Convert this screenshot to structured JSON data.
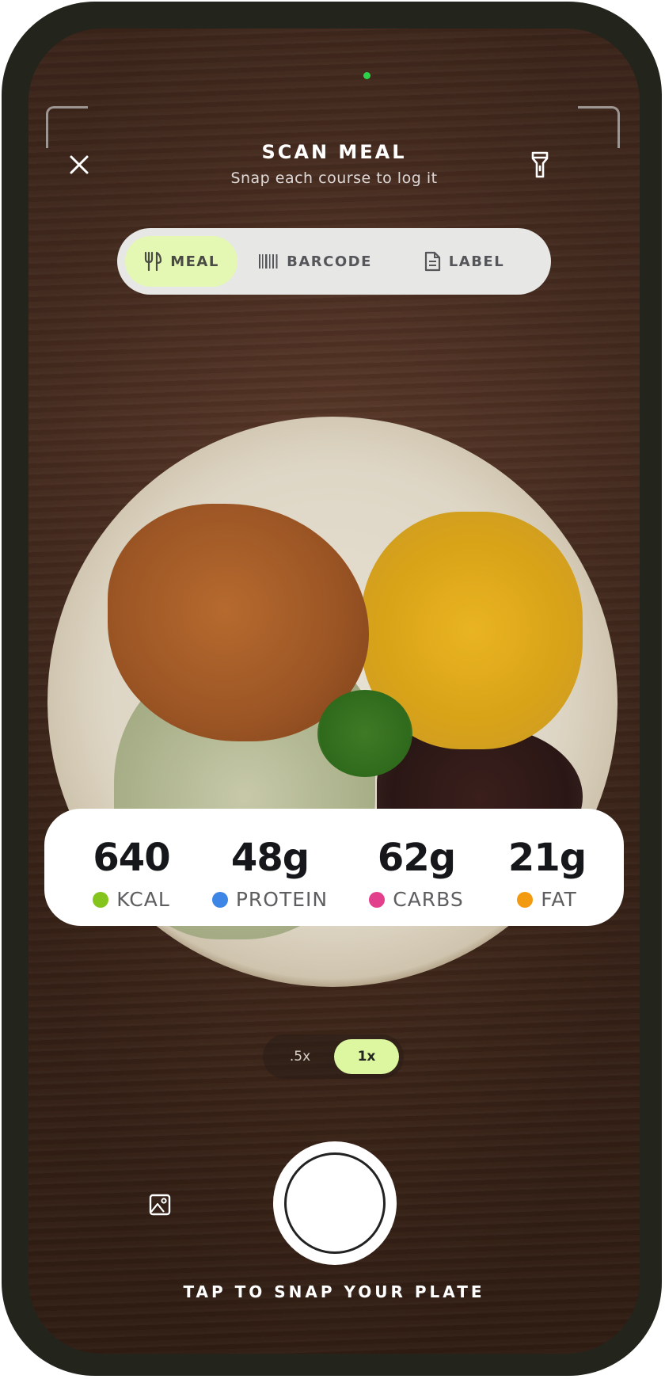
{
  "header": {
    "title": "SCAN MEAL",
    "subtitle": "Snap each course to log it"
  },
  "icons": {
    "close": "close-icon",
    "flash": "flashlight-icon",
    "gallery": "gallery-icon"
  },
  "mode_tabs": [
    {
      "label": "MEAL",
      "icon": "utensils-icon",
      "active": true
    },
    {
      "label": "BARCODE",
      "icon": "barcode-icon",
      "active": false
    },
    {
      "label": "LABEL",
      "icon": "document-icon",
      "active": false
    }
  ],
  "macros": [
    {
      "value": "640",
      "label": "KCAL",
      "color": "#84c41c"
    },
    {
      "value": "48g",
      "label": "PROTEIN",
      "color": "#3e86e6"
    },
    {
      "value": "62g",
      "label": "CARBS",
      "color": "#e23f8c"
    },
    {
      "value": "21g",
      "label": "FAT",
      "color": "#f29a10"
    }
  ],
  "zoom": {
    "options": [
      ".5x",
      "1x"
    ],
    "selected": "1x"
  },
  "shutter_hint": "TAP TO SNAP YOUR PLATE",
  "colors": {
    "accent": "#e4f8b4",
    "zoom_active": "#dcf7a0",
    "status_dot": "#2bd24a"
  }
}
